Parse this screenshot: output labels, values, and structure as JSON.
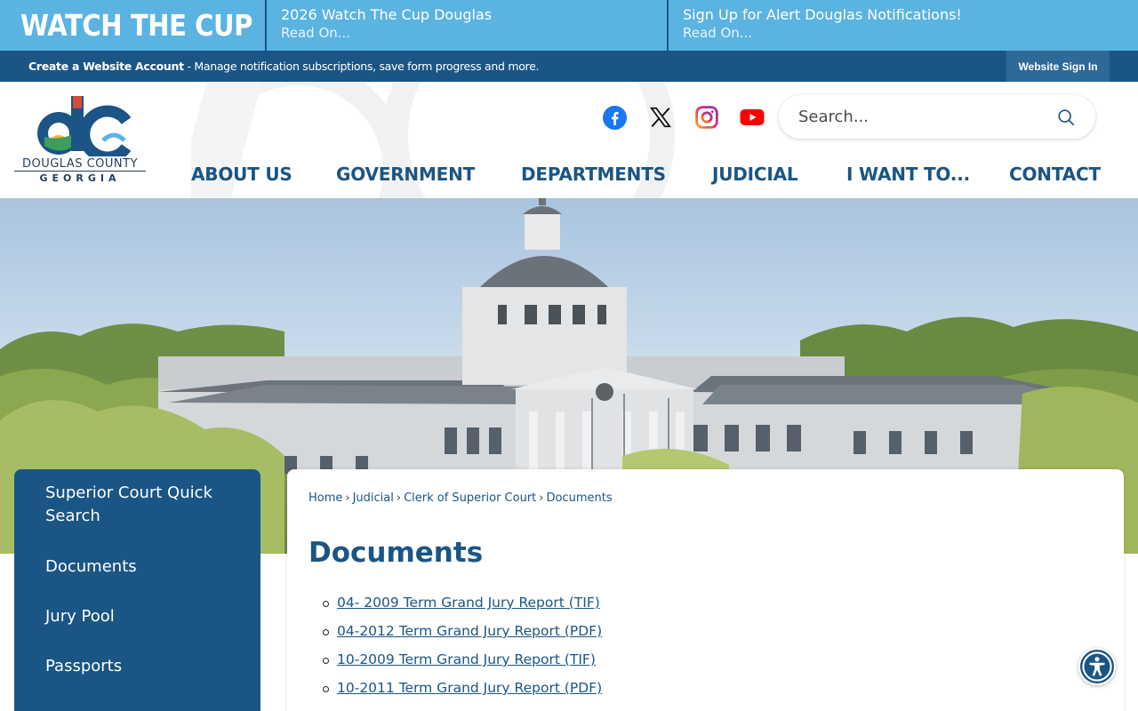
{
  "alert_bar": {
    "brand": "WATCH THE CUP",
    "items": [
      {
        "title": "2026 Watch The Cup Douglas",
        "more": "Read On..."
      },
      {
        "title": "Sign Up for Alert Douglas Notifications!",
        "more": "Read On..."
      }
    ]
  },
  "account_bar": {
    "create_label": "Create a Website Account",
    "create_desc": " - Manage notification subscriptions, save form progress and more.",
    "signin_label": "Website Sign In"
  },
  "header": {
    "logo_line1": "DOUGLAS COUNTY",
    "logo_line2": "GEORGIA",
    "search_placeholder": "Search...",
    "social": [
      "facebook-icon",
      "x-icon",
      "instagram-icon",
      "youtube-icon"
    ],
    "nav": [
      "ABOUT US",
      "GOVERNMENT",
      "DEPARTMENTS",
      "JUDICIAL",
      "I WANT TO...",
      "CONTACT"
    ]
  },
  "sidenav": {
    "items": [
      "Superior Court Quick Search",
      "Documents",
      "Jury Pool",
      "Passports"
    ]
  },
  "content": {
    "breadcrumb": [
      "Home",
      "Judicial",
      "Clerk of Superior Court",
      "Documents"
    ],
    "title": "Documents",
    "documents": [
      "04- 2009 Term Grand Jury Report (TIF)",
      "04-2012 Term Grand Jury Report (PDF)",
      "10-2009 Term Grand Jury Report (TIF)",
      "10-2011 Term Grand Jury Report (PDF)"
    ]
  },
  "colors": {
    "brand_blue": "#1a5585",
    "alert_blue": "#5bb3e2",
    "facebook": "#1877f2",
    "youtube": "#ff0000"
  }
}
